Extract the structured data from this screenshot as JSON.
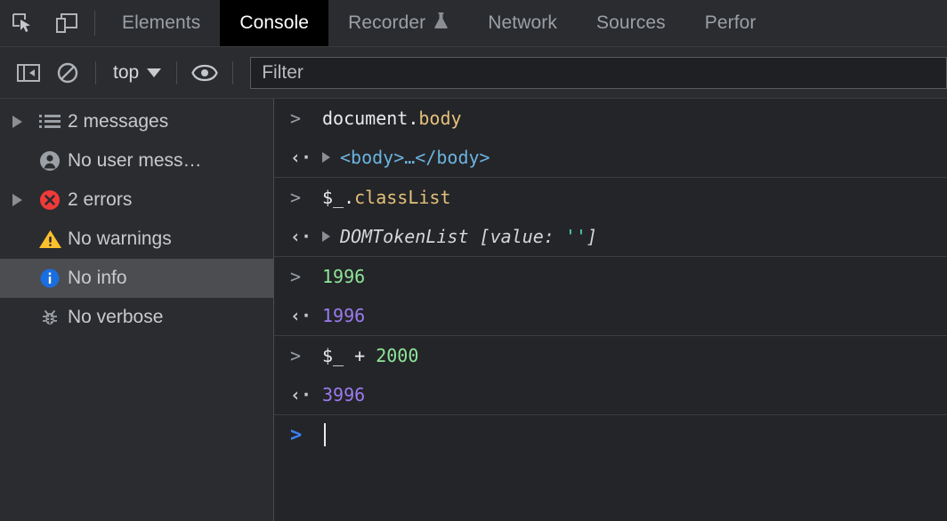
{
  "window": {
    "title": "Chrome DevTools Console",
    "bg": "#242528",
    "panel_bg": "#2b2c2f",
    "active_tab_bg": "#000000"
  },
  "tabbar": {
    "inspect_icon": "inspect-element-icon",
    "device_icon": "device-toolbar-icon",
    "tabs": [
      {
        "label": "Elements",
        "active": false,
        "experimental": false
      },
      {
        "label": "Console",
        "active": true,
        "experimental": false
      },
      {
        "label": "Recorder",
        "active": false,
        "experimental": true,
        "experimental_icon": "flask-icon"
      },
      {
        "label": "Network",
        "active": false,
        "experimental": false
      },
      {
        "label": "Sources",
        "active": false,
        "experimental": false
      },
      {
        "label": "Perfor",
        "active": false,
        "experimental": false
      }
    ]
  },
  "toolbar": {
    "sidebar_toggle_icon": "sidebar-panel-icon",
    "clear_console_icon": "clear-console-icon",
    "context_label": "top",
    "context_caret_icon": "chevron-down-icon",
    "eye_icon": "live-expression-eye-icon",
    "filter": {
      "placeholder": "Filter",
      "value": ""
    }
  },
  "sidebar": {
    "items": [
      {
        "label": "2 messages",
        "icon": "list-icon",
        "expandable": true,
        "selected": false,
        "icon_color": "#9aa0a6"
      },
      {
        "label": "No user mess…",
        "icon": "person-icon",
        "expandable": false,
        "selected": false,
        "icon_color": "#9aa0a6"
      },
      {
        "label": "2 errors",
        "icon": "error-icon",
        "expandable": true,
        "selected": false,
        "icon_color": "#f03a3a"
      },
      {
        "label": "No warnings",
        "icon": "warning-icon",
        "expandable": false,
        "selected": false,
        "icon_color": "#fbc02d"
      },
      {
        "label": "No info",
        "icon": "info-icon",
        "expandable": false,
        "selected": true,
        "icon_color": "#1a6ee0"
      },
      {
        "label": "No verbose",
        "icon": "bug-icon",
        "expandable": false,
        "selected": false,
        "icon_color": "#9aa0a6"
      }
    ]
  },
  "console": {
    "groups": [
      {
        "input": {
          "gutter": ">",
          "tokens": [
            {
              "text": "document.",
              "style": "plain"
            },
            {
              "text": "body",
              "style": "prop"
            }
          ]
        },
        "output": {
          "gutter": "‹·",
          "expandable": true,
          "tokens": [
            {
              "text": "<body>…</body>",
              "style": "tag"
            }
          ]
        }
      },
      {
        "input": {
          "gutter": ">",
          "tokens": [
            {
              "text": "$_.",
              "style": "plain"
            },
            {
              "text": "classList",
              "style": "prop"
            }
          ]
        },
        "output": {
          "gutter": "‹·",
          "expandable": true,
          "tokens": [
            {
              "text": "DOMTokenList [value: ",
              "style": "ital"
            },
            {
              "text": "''",
              "style": "str"
            },
            {
              "text": "]",
              "style": "ital"
            }
          ]
        }
      },
      {
        "input": {
          "gutter": ">",
          "tokens": [
            {
              "text": "1996",
              "style": "num-in"
            }
          ]
        },
        "output": {
          "gutter": "‹·",
          "expandable": false,
          "tokens": [
            {
              "text": "1996",
              "style": "num-out"
            }
          ]
        }
      },
      {
        "input": {
          "gutter": ">",
          "tokens": [
            {
              "text": "$_ + ",
              "style": "plain"
            },
            {
              "text": "2000",
              "style": "num-in"
            }
          ]
        },
        "output": {
          "gutter": "‹·",
          "expandable": false,
          "tokens": [
            {
              "text": "3996",
              "style": "num-out"
            }
          ]
        }
      }
    ],
    "prompt": {
      "gutter": ">",
      "value": "",
      "cursor_visible": true
    }
  }
}
